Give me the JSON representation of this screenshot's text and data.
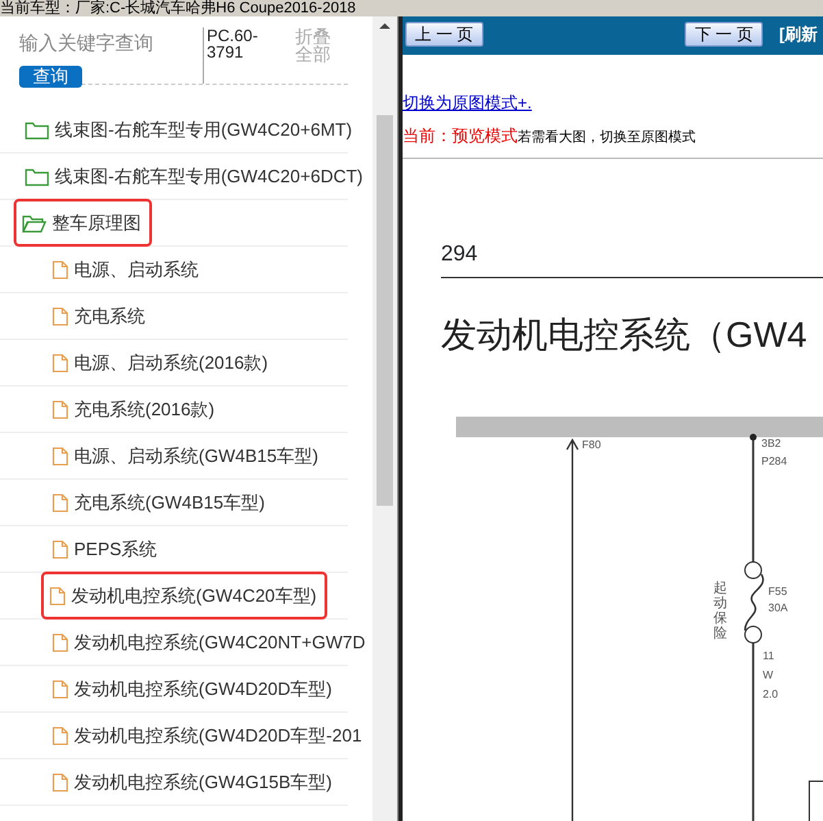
{
  "header": {
    "vehicle": "当前车型：厂家:C-长城汽车哈弗H6 Coupe2016-2018"
  },
  "sidebar": {
    "search": {
      "placeholder": "输入关键字查询"
    },
    "search_button": "查询",
    "code": "PC.60-3791",
    "collapse_all": "折叠全部",
    "items": [
      {
        "label": "线束图-右舵车型专用(GW4C20+6MT)",
        "kind": "folder",
        "expanded": false,
        "highlighted": false
      },
      {
        "label": "线束图-右舵车型专用(GW4C20+6DCT)",
        "kind": "folder",
        "expanded": false,
        "highlighted": false
      },
      {
        "label": "整车原理图",
        "kind": "folder",
        "expanded": true,
        "highlighted": true,
        "children": [
          {
            "label": "电源、启动系统",
            "kind": "file",
            "highlighted": false
          },
          {
            "label": "充电系统",
            "kind": "file",
            "highlighted": false
          },
          {
            "label": "电源、启动系统(2016款)",
            "kind": "file",
            "highlighted": false
          },
          {
            "label": "充电系统(2016款)",
            "kind": "file",
            "highlighted": false
          },
          {
            "label": "电源、启动系统(GW4B15车型)",
            "kind": "file",
            "highlighted": false
          },
          {
            "label": "充电系统(GW4B15车型)",
            "kind": "file",
            "highlighted": false
          },
          {
            "label": "PEPS系统",
            "kind": "file",
            "highlighted": false
          },
          {
            "label": "发动机电控系统(GW4C20车型)",
            "kind": "file",
            "highlighted": true
          },
          {
            "label": "发动机电控系统(GW4C20NT+GW7D",
            "kind": "file",
            "highlighted": false
          },
          {
            "label": "发动机电控系统(GW4D20D车型)",
            "kind": "file",
            "highlighted": false
          },
          {
            "label": "发动机电控系统(GW4D20D车型-201",
            "kind": "file",
            "highlighted": false
          },
          {
            "label": "发动机电控系统(GW4G15B车型)",
            "kind": "file",
            "highlighted": false
          }
        ]
      }
    ]
  },
  "viewer": {
    "prev_button": "上 一 页",
    "next_button": "下 一 页",
    "refresh": "[刷新",
    "mode_link": "切换为原图模式+.",
    "mode_status": "当前：预览模式",
    "mode_hint": "若需看大图，切换至原图模式",
    "page_number": "294",
    "title": "发动机电控系统（GW4",
    "diagram": {
      "labels": [
        "F80",
        "3B2",
        "P284",
        "F55",
        "30A",
        "11",
        "W",
        "2.0"
      ],
      "fuse_label": "起动保险"
    }
  }
}
